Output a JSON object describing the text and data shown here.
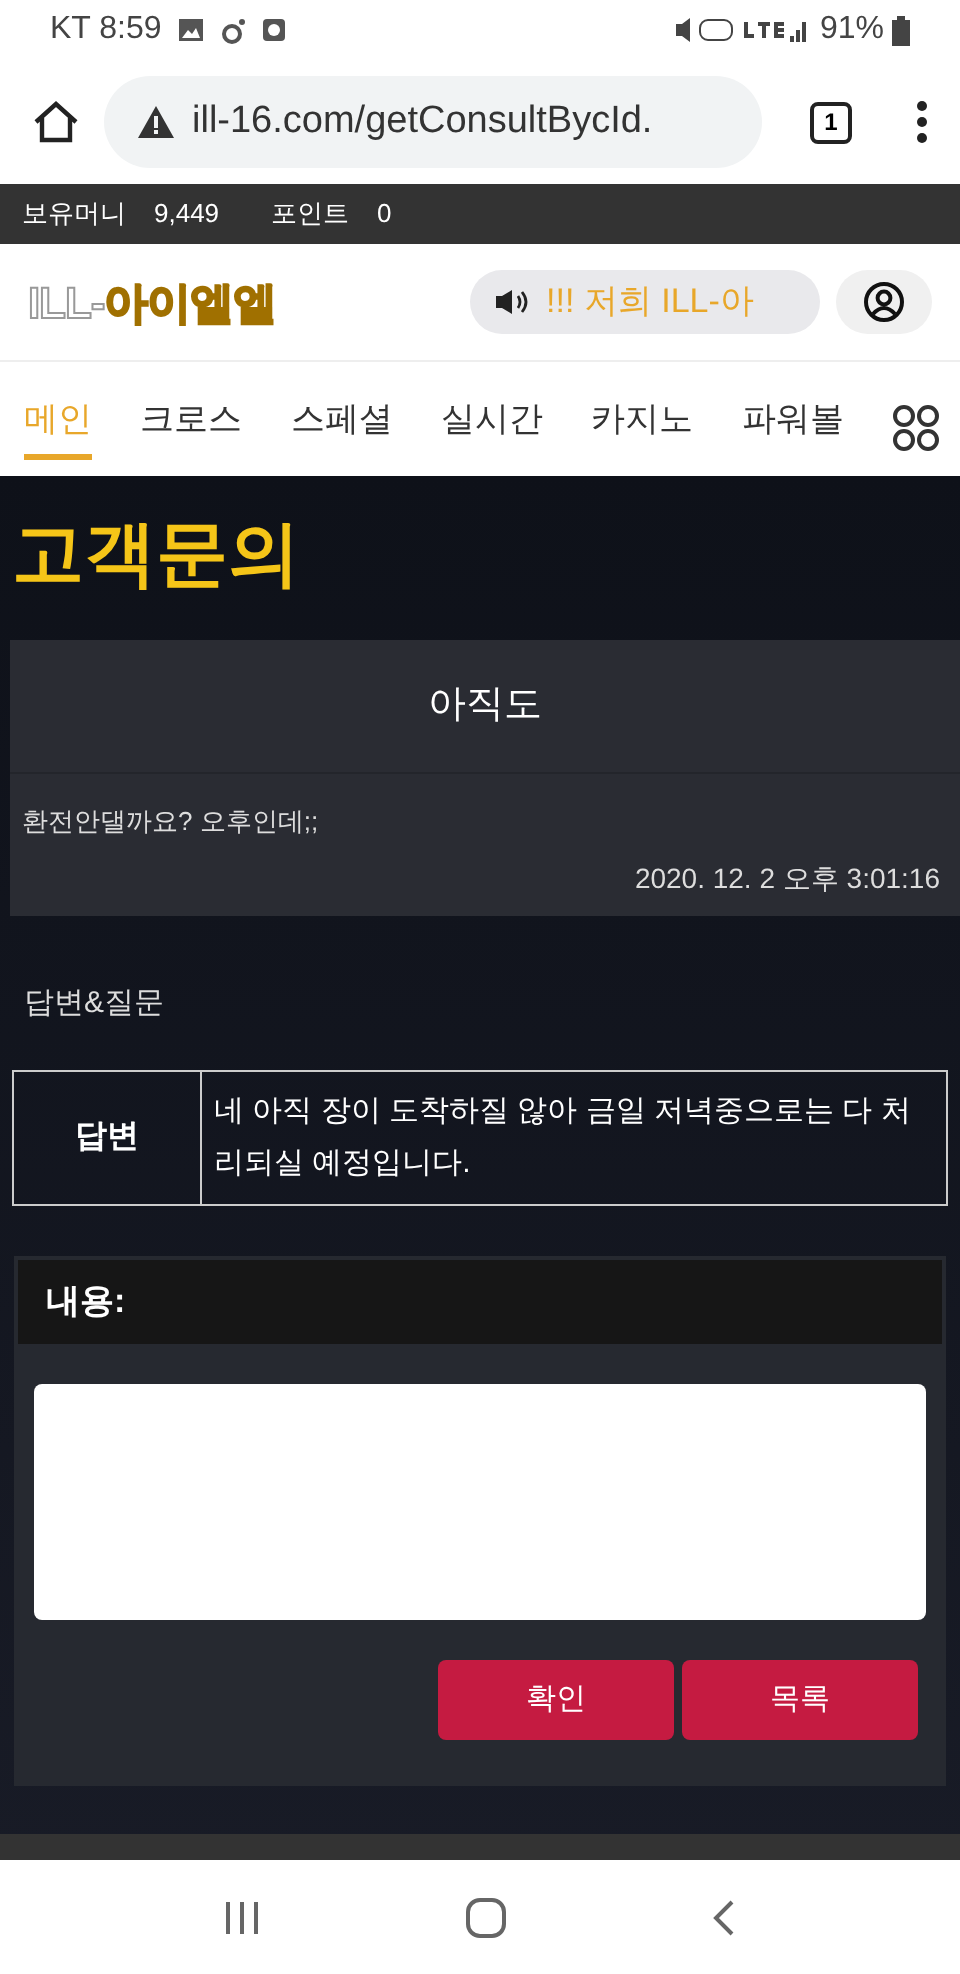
{
  "status_bar": {
    "carrier_time": "KT 8:59",
    "battery": "91%"
  },
  "browser": {
    "url": "ill-16.com/getConsultBycId.",
    "tab_count": "1"
  },
  "account_bar": [
    {
      "label": "보유머니",
      "value": "9,449"
    },
    {
      "label": "포인트",
      "value": "0"
    }
  ],
  "header": {
    "logo_prefix": "ILL-",
    "logo_name": "아이엘엘",
    "notice": "!!! 저희 ILL-아"
  },
  "nav_tabs": [
    {
      "label": "메인",
      "selected": true
    },
    {
      "label": "크로스",
      "selected": false
    },
    {
      "label": "스페셜",
      "selected": false
    },
    {
      "label": "실시간",
      "selected": false
    },
    {
      "label": "카지노",
      "selected": false
    },
    {
      "label": "파워볼",
      "selected": false
    }
  ],
  "page_title": "고객문의",
  "inquiry": {
    "subject": "아직도",
    "body": "환전안댈까요? 오후인데;;",
    "date": "2020. 12. 2 오후 3:01:16"
  },
  "section_label": "답변&질문",
  "answer": {
    "label": "답변",
    "text": "네 아직 장이 도착하질 않아 금일 저녁중으로는 다 처리되실 예정입니다."
  },
  "form": {
    "label": "내용:",
    "buttons": [
      "확인",
      "목록"
    ]
  }
}
